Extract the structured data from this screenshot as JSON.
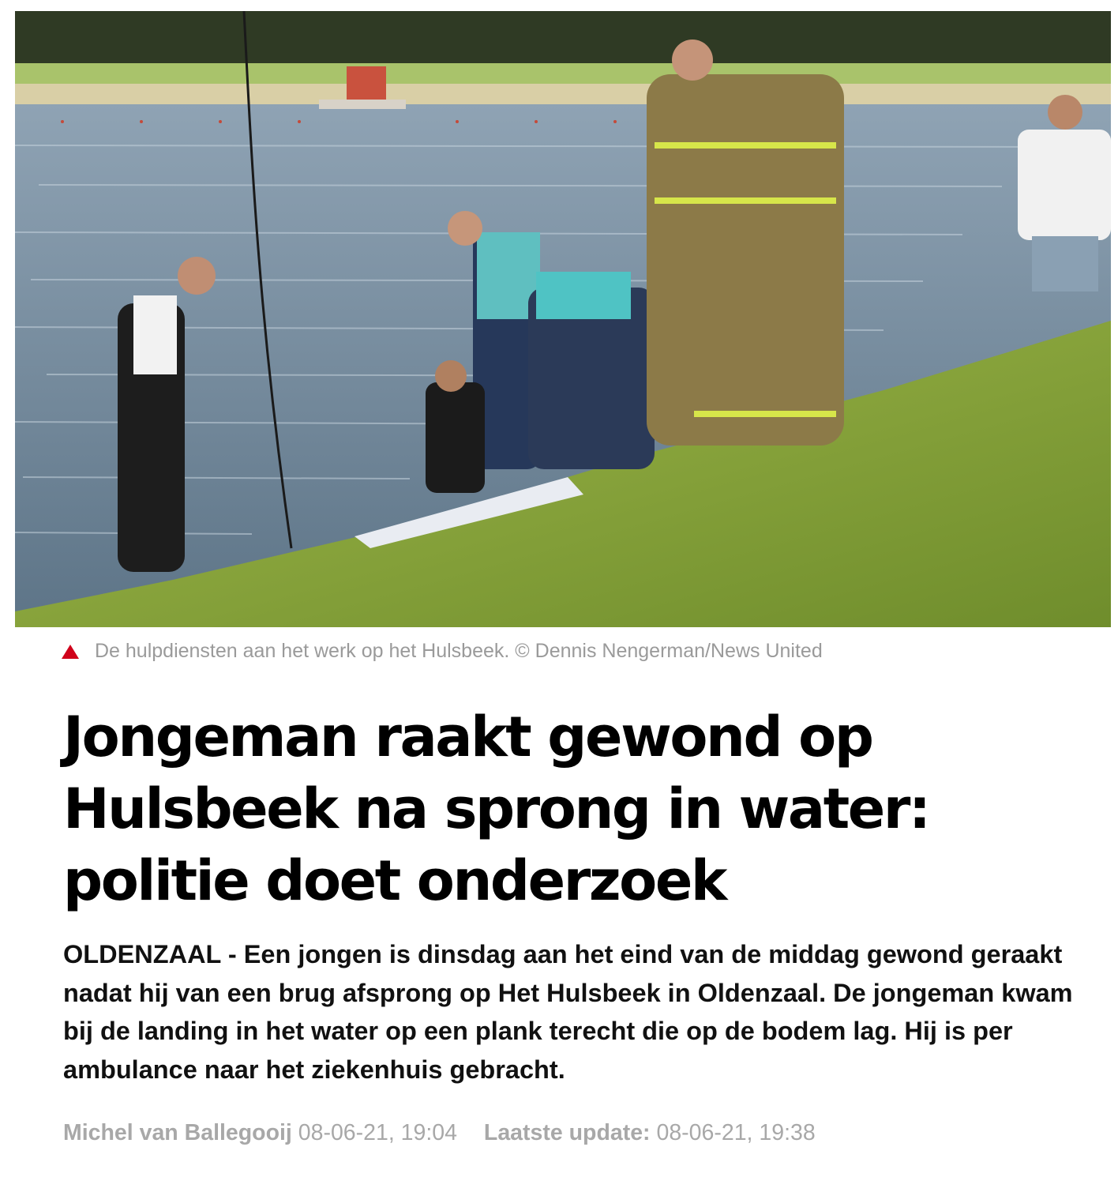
{
  "image": {
    "alt": "De hulpdiensten aan het werk op het Hulsbeek."
  },
  "caption": {
    "icon": "triangle-up-icon",
    "icon_color": "#d0021b",
    "text": "De hulpdiensten aan het werk op het Hulsbeek. © Dennis Nengerman/News United"
  },
  "article": {
    "headline": "Jongeman raakt gewond op Hulsbeek na sprong in water: politie doet onderzoek",
    "intro": "OLDENZAAL - Een jongen is dinsdag aan het eind van de middag gewond geraakt nadat hij van een brug afsprong op Het Hulsbeek in Oldenzaal. De jongeman kwam bij de landing in het water op een plank terecht die op de bodem lag. Hij is per ambulance naar het ziekenhuis gebracht."
  },
  "meta": {
    "author": "Michel van Ballegooij",
    "published": "08-06-21, 19:04",
    "update_label": "Laatste update:",
    "updated": "08-06-21, 19:38"
  }
}
